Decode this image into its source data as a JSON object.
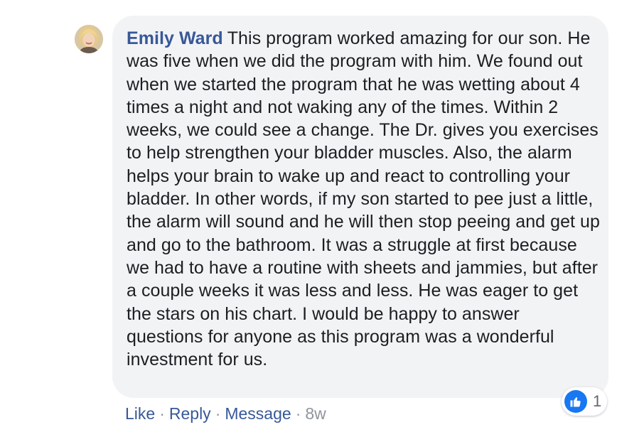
{
  "comment": {
    "author": "Emily Ward",
    "text": "This program worked amazing for our son. He was five when we did the program with him. We found out when we started the program that he was wetting about 4 times a night and not waking any of the times. Within 2 weeks, we could see a change. The Dr. gives you exercises to help strengthen your bladder muscles. Also, the alarm helps your brain to wake up and react to controlling your bladder. In other words, if my son started to pee just a little, the alarm will sound and he will then stop peeing and get up and go to the bathroom. It was a struggle at first because we had to have a routine with sheets and jammies, but after a couple weeks it was less and less. He was eager to get the stars on his chart. I would be happy to answer questions for anyone as this program was a wonderful investment for us."
  },
  "actions": {
    "like": "Like",
    "reply": "Reply",
    "message": "Message",
    "separator": "·",
    "timestamp": "8w"
  },
  "reactions": {
    "icon": "thumbs-up-icon",
    "count": "1",
    "color": "#1877f2"
  },
  "colors": {
    "author": "#385898",
    "bubble": "#f2f3f5",
    "text": "#1c1e21",
    "meta": "#90949c"
  }
}
